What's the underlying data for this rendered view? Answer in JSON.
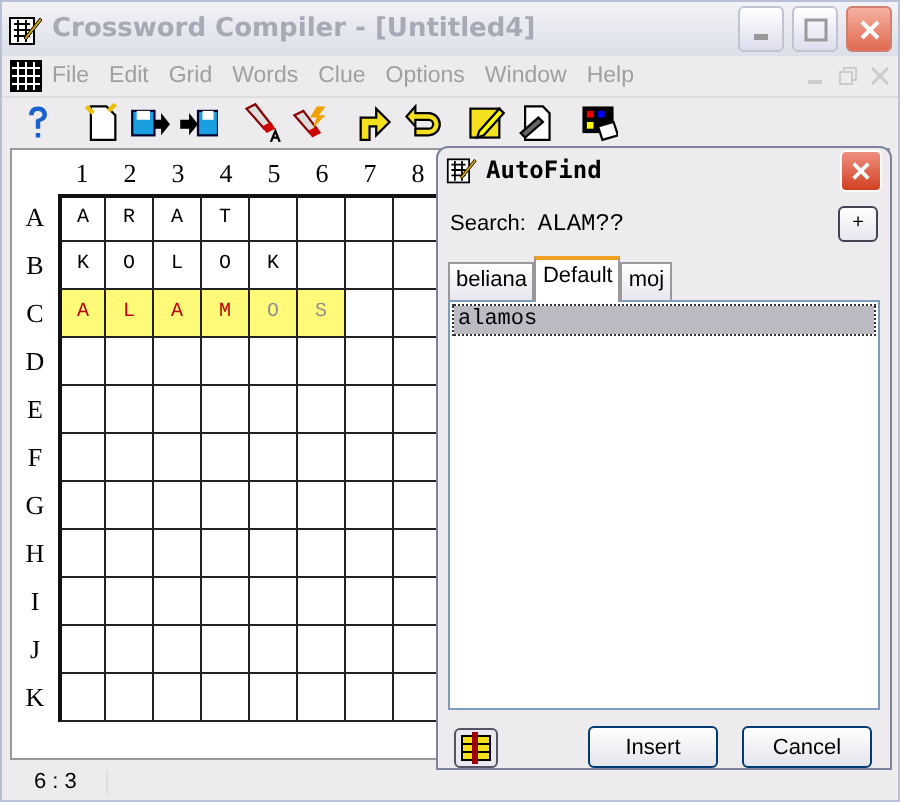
{
  "window": {
    "title": "Crossword Compiler - [Untitled4]"
  },
  "menu": [
    "File",
    "Edit",
    "Grid",
    "Words",
    "Clue",
    "Options",
    "Window",
    "Help"
  ],
  "grid": {
    "columns": [
      "1",
      "2",
      "3",
      "4",
      "5",
      "6",
      "7",
      "8"
    ],
    "rows": [
      {
        "label": "A",
        "cells": [
          {
            "letter": "A",
            "highlighted": false
          },
          {
            "letter": "R",
            "highlighted": false
          },
          {
            "letter": "A",
            "highlighted": false
          },
          {
            "letter": "T",
            "highlighted": false
          },
          {
            "highlighted": false
          },
          {
            "highlighted": false
          },
          {
            "highlighted": false
          },
          {
            "highlighted": false
          }
        ]
      },
      {
        "label": "B",
        "cells": [
          {
            "letter": "K",
            "highlighted": false
          },
          {
            "letter": "O",
            "highlighted": false
          },
          {
            "letter": "L",
            "highlighted": false
          },
          {
            "letter": "O",
            "highlighted": false
          },
          {
            "letter": "K",
            "highlighted": false
          },
          {
            "highlighted": false
          },
          {
            "highlighted": false
          },
          {
            "highlighted": false
          }
        ]
      },
      {
        "label": "C",
        "cells": [
          {
            "letter": "A",
            "highlighted": true,
            "kind": "pattern"
          },
          {
            "letter": "L",
            "highlighted": true,
            "kind": "pattern"
          },
          {
            "letter": "A",
            "highlighted": true,
            "kind": "pattern"
          },
          {
            "letter": "M",
            "highlighted": true,
            "kind": "pattern"
          },
          {
            "letter": "O",
            "highlighted": true,
            "kind": "suggested"
          },
          {
            "letter": "S",
            "highlighted": true,
            "kind": "suggested"
          },
          {
            "highlighted": false
          },
          {
            "highlighted": false
          }
        ]
      },
      {
        "label": "D",
        "cells": [
          {
            "highlighted": false
          },
          {
            "highlighted": false
          },
          {
            "highlighted": false
          },
          {
            "highlighted": false
          },
          {
            "highlighted": false
          },
          {
            "highlighted": false
          },
          {
            "highlighted": false
          },
          {
            "highlighted": false
          }
        ]
      },
      {
        "label": "E",
        "cells": [
          {
            "highlighted": false
          },
          {
            "highlighted": false
          },
          {
            "highlighted": false
          },
          {
            "highlighted": false
          },
          {
            "highlighted": false
          },
          {
            "highlighted": false
          },
          {
            "highlighted": false
          },
          {
            "highlighted": false
          }
        ]
      },
      {
        "label": "F",
        "cells": [
          {
            "highlighted": false
          },
          {
            "highlighted": false
          },
          {
            "highlighted": false
          },
          {
            "highlighted": false
          },
          {
            "highlighted": false
          },
          {
            "highlighted": false
          },
          {
            "highlighted": false
          },
          {
            "highlighted": false
          }
        ]
      },
      {
        "label": "G",
        "cells": [
          {
            "highlighted": false
          },
          {
            "highlighted": false
          },
          {
            "highlighted": false
          },
          {
            "highlighted": false
          },
          {
            "highlighted": false
          },
          {
            "highlighted": false
          },
          {
            "highlighted": false
          },
          {
            "highlighted": false
          }
        ]
      },
      {
        "label": "H",
        "cells": [
          {
            "highlighted": false
          },
          {
            "highlighted": false
          },
          {
            "highlighted": false
          },
          {
            "highlighted": false
          },
          {
            "highlighted": false
          },
          {
            "highlighted": false
          },
          {
            "highlighted": false
          },
          {
            "highlighted": false
          }
        ]
      },
      {
        "label": "I",
        "cells": [
          {
            "highlighted": false
          },
          {
            "highlighted": false
          },
          {
            "highlighted": false
          },
          {
            "highlighted": false
          },
          {
            "highlighted": false
          },
          {
            "highlighted": false
          },
          {
            "highlighted": false
          },
          {
            "highlighted": false
          }
        ]
      },
      {
        "label": "J",
        "cells": [
          {
            "highlighted": false
          },
          {
            "highlighted": false
          },
          {
            "highlighted": false
          },
          {
            "highlighted": false
          },
          {
            "highlighted": false
          },
          {
            "highlighted": false
          },
          {
            "highlighted": false
          },
          {
            "highlighted": false
          }
        ]
      },
      {
        "label": "K",
        "cells": [
          {
            "highlighted": false
          },
          {
            "highlighted": false
          },
          {
            "highlighted": false
          },
          {
            "highlighted": false
          },
          {
            "highlighted": false
          },
          {
            "highlighted": false
          },
          {
            "highlighted": false
          },
          {
            "highlighted": false
          }
        ]
      }
    ]
  },
  "dialog": {
    "title": "AutoFind",
    "search_label": "Search:",
    "search_value": "ALAM??",
    "add_button": "+",
    "tabs": [
      {
        "label": "beliana",
        "selected": false
      },
      {
        "label": "Default",
        "selected": true
      },
      {
        "label": "moj",
        "selected": false
      }
    ],
    "results": [
      {
        "word": "alamos",
        "selected": true
      }
    ],
    "buttons": [
      "Insert",
      "Cancel"
    ]
  },
  "status_bar": {
    "position": "6 : 3"
  }
}
